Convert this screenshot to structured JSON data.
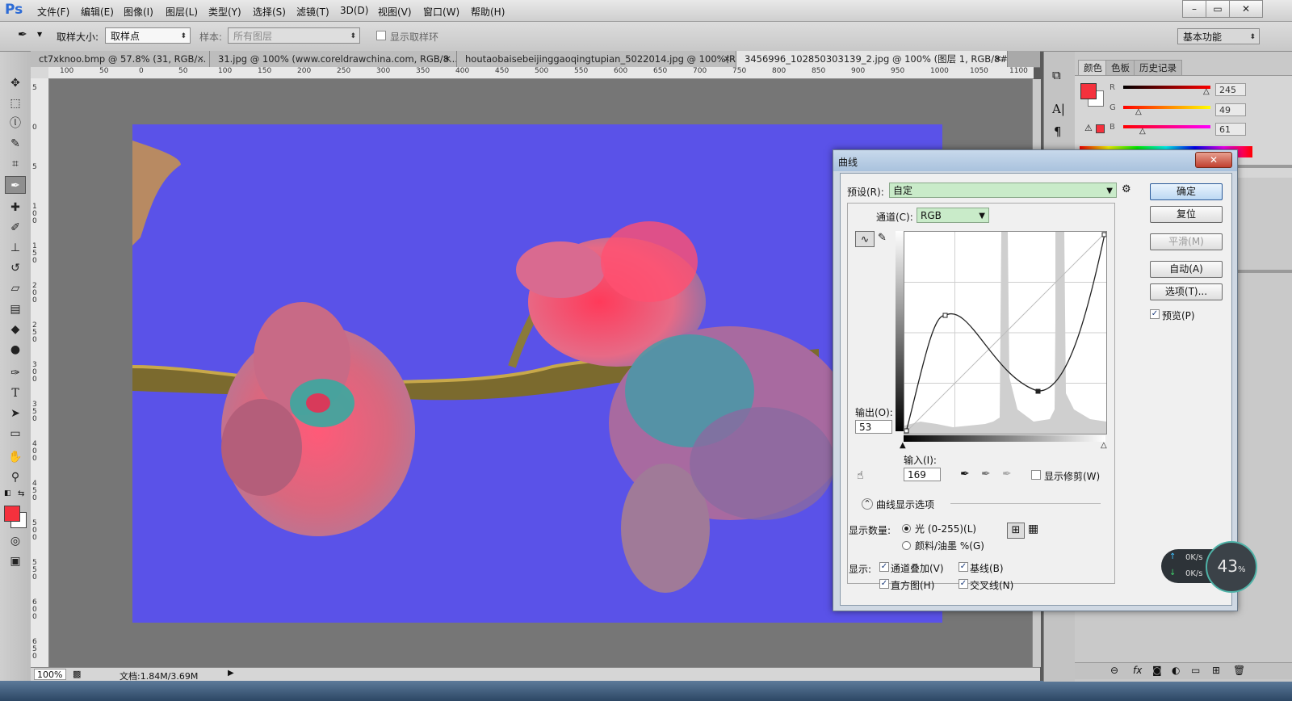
{
  "app": {
    "logo": "Ps",
    "menu": [
      "文件(F)",
      "编辑(E)",
      "图像(I)",
      "图层(L)",
      "类型(Y)",
      "选择(S)",
      "滤镜(T)",
      "3D(D)",
      "视图(V)",
      "窗口(W)",
      "帮助(H)"
    ],
    "window_controls": [
      "–",
      "▭",
      "✕"
    ]
  },
  "options_bar": {
    "sample_size_label": "取样大小:",
    "sample_size_value": "取样点",
    "sample_label": "样本:",
    "sample_value": "所有图层",
    "show_ring_label": "显示取样环",
    "workspace": "基本功能"
  },
  "tabs": [
    {
      "label": "ct7xknoo.bmp @ 57.8% (31, RGB/...",
      "close": "×"
    },
    {
      "label": "31.jpg @ 100% (www.coreldrawchina.com, RGB/8...",
      "close": "×"
    },
    {
      "label": "houtaobaisebeijinggaoqingtupian_5022014.jpg @ 100%(R...",
      "close": "×"
    },
    {
      "label": "3456996_102850303139_2.jpg @ 100% (图层 1, RGB/8#) *",
      "close": "×"
    }
  ],
  "ruler": {
    "h_ticks": [
      "100",
      "50",
      "0",
      "50",
      "100",
      "150",
      "200",
      "250",
      "300",
      "350",
      "400",
      "450",
      "500",
      "550",
      "600",
      "650",
      "700",
      "750",
      "800",
      "850",
      "900",
      "950",
      "1000",
      "1050",
      "1100"
    ],
    "v_ticks": [
      "5",
      "0",
      "5",
      "1 0 0",
      "1 5 0",
      "2 0 0",
      "2 5 0",
      "3 0 0",
      "3 5 0",
      "4 0 0",
      "4 5 0",
      "5 0 0",
      "5 5 0",
      "6 0 0",
      "6 5 0"
    ]
  },
  "status": {
    "zoom": "100%",
    "doc": "文档:1.84M/3.69M"
  },
  "right_panel": {
    "tabs": [
      "颜色",
      "色板",
      "历史记录"
    ],
    "r_label": "R",
    "g_label": "G",
    "b_label": "B",
    "r_value": "245",
    "g_value": "49",
    "b_value": "61",
    "fg_color": "#f5313d"
  },
  "curves": {
    "title": "曲线",
    "preset_label": "预设(R):",
    "preset_value": "自定",
    "channel_label": "通道(C):",
    "channel_value": "RGB",
    "ok": "确定",
    "reset": "复位",
    "smooth": "平滑(M)",
    "auto": "自动(A)",
    "options": "选项(T)...",
    "preview": "预览(P)",
    "output_label": "输出(O):",
    "output_value": "53",
    "input_label": "输入(I):",
    "input_value": "169",
    "show_clipping": "显示修剪(W)",
    "display_options": "曲线显示选项",
    "show_amount_label": "显示数量:",
    "light_option": "光 (0-255)(L)",
    "pigment_option": "颜料/油墨 %(G)",
    "show_label": "显示:",
    "channel_overlay": "通道叠加(V)",
    "baseline": "基线(B)",
    "histogram": "直方图(H)",
    "intersection": "交叉线(N)"
  },
  "net_widget": {
    "up": "0K/s",
    "down": "0K/s",
    "percent": "43",
    "percent_unit": "%"
  }
}
